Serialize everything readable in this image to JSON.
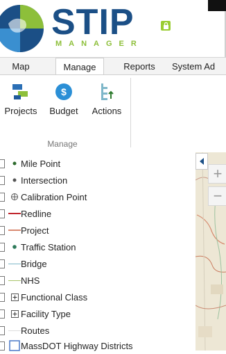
{
  "app": {
    "title": "STIP",
    "subtitle": "MANAGER"
  },
  "tabs": [
    {
      "label": "Map",
      "active": false
    },
    {
      "label": "Manage",
      "active": true
    },
    {
      "label": "Reports",
      "active": false
    },
    {
      "label": "System Ad",
      "active": false
    }
  ],
  "ribbon": {
    "buttons": [
      {
        "label": "Projects",
        "icon": "projects-icon"
      },
      {
        "label": "Budget",
        "icon": "budget-icon"
      },
      {
        "label": "Actions",
        "icon": "actions-icon"
      }
    ],
    "group_label": "Manage"
  },
  "layers": [
    {
      "label": "Mile Point",
      "symbol": "dot",
      "color": "#2d6a2d"
    },
    {
      "label": "Intersection",
      "symbol": "dot",
      "color": "#555555"
    },
    {
      "label": "Calibration Point",
      "symbol": "crosshair",
      "color": "#555555"
    },
    {
      "label": "Redline",
      "symbol": "line",
      "color": "#c0262d"
    },
    {
      "label": "Project",
      "symbol": "line",
      "color": "#d98a72"
    },
    {
      "label": "Traffic Station",
      "symbol": "dot",
      "color": "#2d7a5a"
    },
    {
      "label": "Bridge",
      "symbol": "line",
      "color": "#7fb7c9"
    },
    {
      "label": "NHS",
      "symbol": "line",
      "color": "#a9c46a"
    },
    {
      "label": "Functional Class",
      "symbol": "expand",
      "color": "#555555"
    },
    {
      "label": "Facility Type",
      "symbol": "expand",
      "color": "#555555"
    },
    {
      "label": "Routes",
      "symbol": "line",
      "color": "#dddddd"
    },
    {
      "label": "MassDOT Highway Districts",
      "symbol": "box",
      "color": "#4a79c9"
    }
  ],
  "map_controls": {
    "zoom_in": "+",
    "zoom_out": "−"
  },
  "colors": {
    "brand": "#1b4f86",
    "accent": "#8dbf3a"
  }
}
